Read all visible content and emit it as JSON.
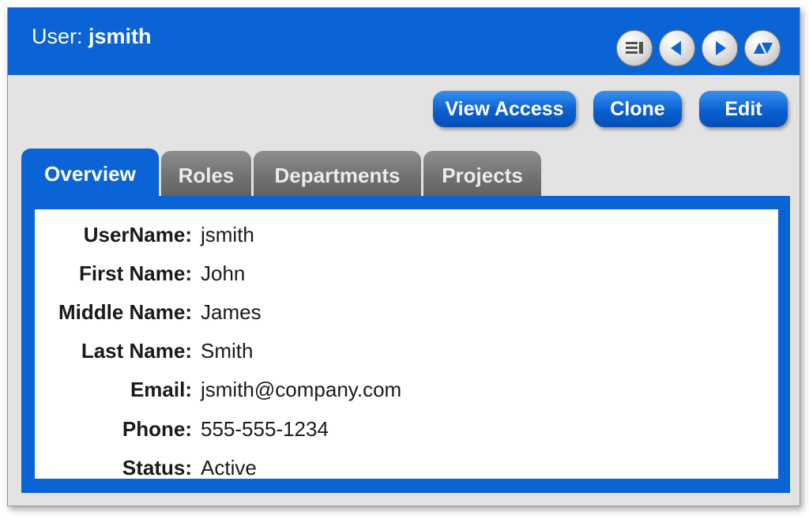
{
  "header": {
    "title_prefix": "User:",
    "title_user": "jsmith",
    "nav_icons": [
      "list-view-icon",
      "previous-icon",
      "next-icon",
      "sort-icon"
    ]
  },
  "toolbar": {
    "view_access_label": "View Access",
    "clone_label": "Clone",
    "edit_label": "Edit"
  },
  "tabs": [
    {
      "label": "Overview",
      "active": true
    },
    {
      "label": "Roles",
      "active": false
    },
    {
      "label": "Departments",
      "active": false
    },
    {
      "label": "Projects",
      "active": false
    }
  ],
  "fields": [
    {
      "label": "UserName:",
      "value": "jsmith"
    },
    {
      "label": "First Name:",
      "value": "John"
    },
    {
      "label": "Middle Name:",
      "value": "James"
    },
    {
      "label": "Last Name:",
      "value": "Smith"
    },
    {
      "label": "Email:",
      "value": "jsmith@company.com"
    },
    {
      "label": "Phone:",
      "value": "555-555-1234"
    },
    {
      "label": "Status:",
      "value": "Active"
    }
  ],
  "colors": {
    "accent": "#0a64d6",
    "inactive_tab": "#727272",
    "background": "#e3e3e3"
  }
}
